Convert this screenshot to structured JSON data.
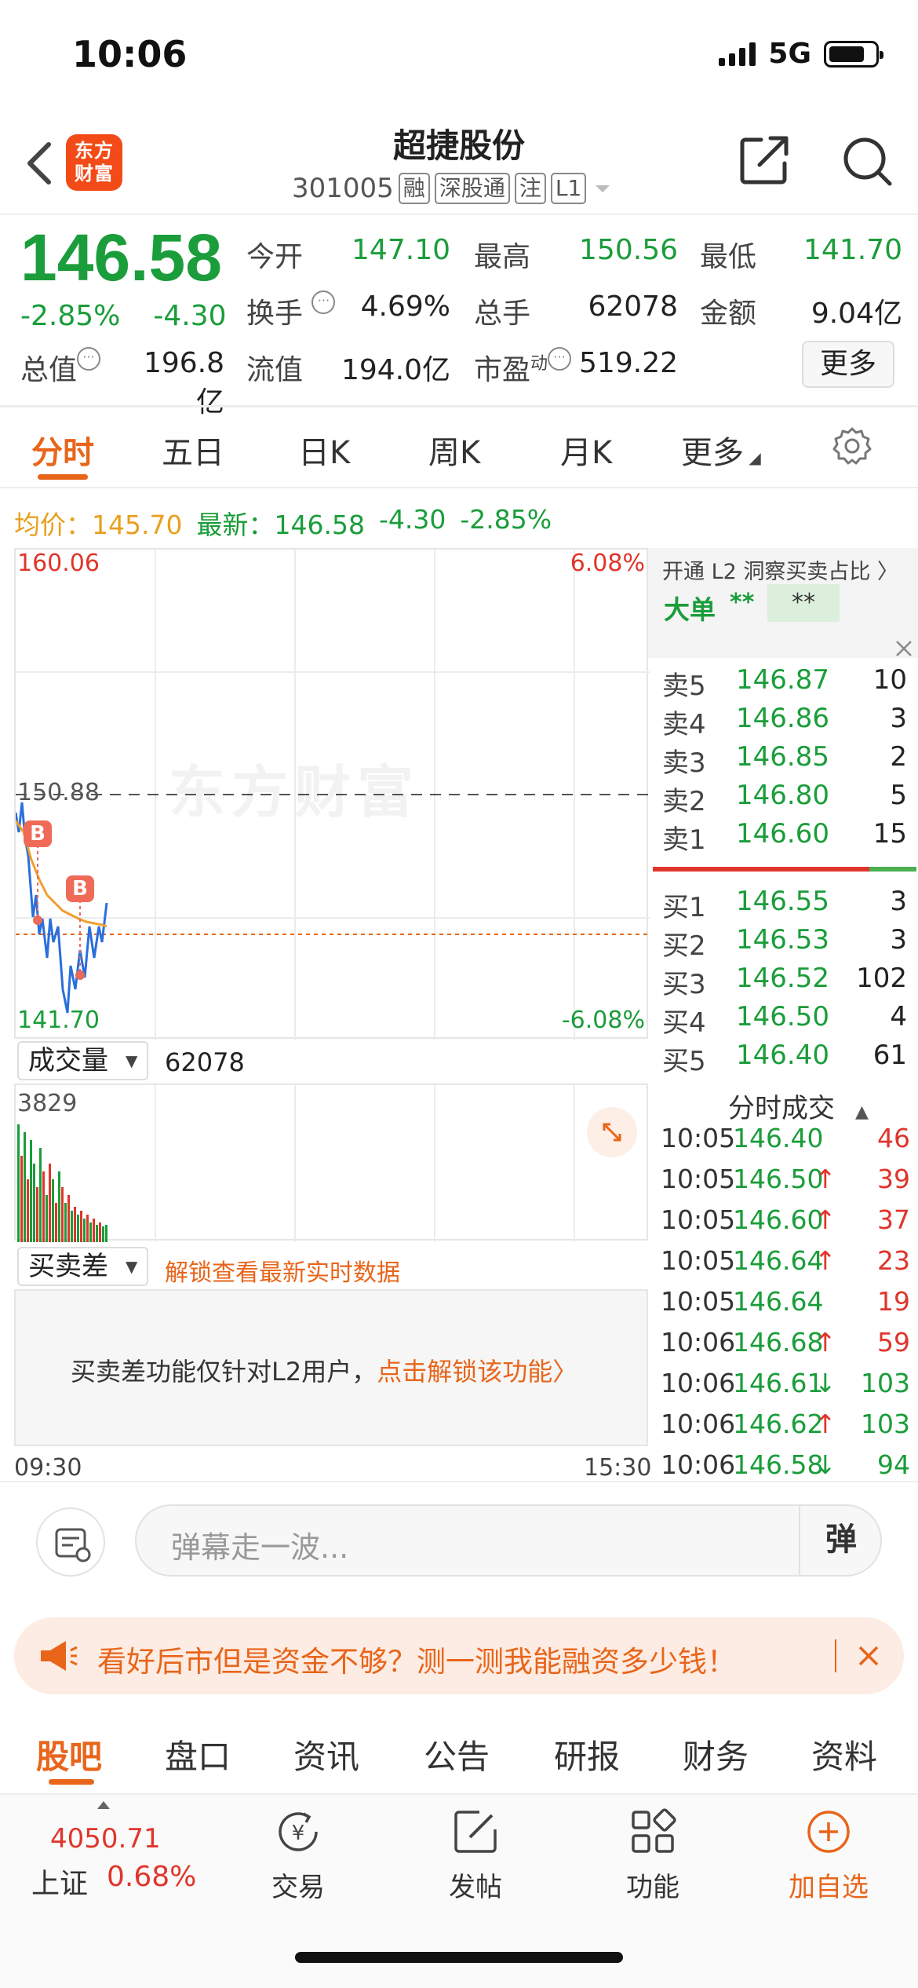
{
  "status_bar": {
    "time": "10:06",
    "network": "5G"
  },
  "header": {
    "logo_text_1": "东方",
    "logo_text_2": "财富",
    "stock_name": "超捷股份",
    "stock_code": "301005",
    "tags": [
      "融",
      "深股通",
      "注",
      "L1"
    ]
  },
  "quote": {
    "price": "146.58",
    "change_pct": "-2.85%",
    "change": "-4.30",
    "open_label": "今开",
    "open": "147.10",
    "high_label": "最高",
    "high": "150.56",
    "low_label": "最低",
    "low": "141.70",
    "turnover_label": "换手",
    "turnover": "4.69%",
    "volume_label": "总手",
    "volume": "62078",
    "amount_label": "金额",
    "amount": "9.04亿",
    "mktcap_label": "总值",
    "mktcap": "196.8亿",
    "float_label": "流值",
    "float": "194.0亿",
    "pe_label": "市盈",
    "pe_sup": "动",
    "pe": "519.22",
    "more_label": "更多"
  },
  "period_tabs": [
    "分时",
    "五日",
    "日K",
    "周K",
    "月K",
    "更多"
  ],
  "avg_row": {
    "avg_label": "均价：",
    "avg": "145.70",
    "latest_label": "最新：",
    "latest": "146.58",
    "change": "-4.30",
    "change_pct": "-2.85%"
  },
  "chart": {
    "y_max": "160.06",
    "y_min": "141.70",
    "y_mid": "150.88",
    "pct_max": "6.08%",
    "pct_min": "-6.08%",
    "watermark": "东方财富",
    "marker": "B",
    "time_start": "09:30",
    "time_end": "15:30",
    "volume_label": "成交量",
    "volume_value": "62078",
    "volume_max": "3829",
    "diff_label": "买卖差",
    "unlock_hint": "解锁查看最新实时数据",
    "diff_msg": "买卖差功能仅针对L2用户，",
    "diff_link": "点击解锁该功能"
  },
  "l2_panel": {
    "title": "开通 L2 洞察买卖占比",
    "big_order_label": "大单",
    "big_order_val": "**",
    "big_order_val2": "**"
  },
  "sell_orders": [
    {
      "label": "卖5",
      "price": "146.87",
      "vol": "10"
    },
    {
      "label": "卖4",
      "price": "146.86",
      "vol": "3"
    },
    {
      "label": "卖3",
      "price": "146.85",
      "vol": "2"
    },
    {
      "label": "卖2",
      "price": "146.80",
      "vol": "5"
    },
    {
      "label": "卖1",
      "price": "146.60",
      "vol": "15"
    }
  ],
  "buy_orders": [
    {
      "label": "买1",
      "price": "146.55",
      "vol": "3"
    },
    {
      "label": "买2",
      "price": "146.53",
      "vol": "3"
    },
    {
      "label": "买3",
      "price": "146.52",
      "vol": "102"
    },
    {
      "label": "买4",
      "price": "146.50",
      "vol": "4"
    },
    {
      "label": "买5",
      "price": "146.40",
      "vol": "61"
    }
  ],
  "ticks_title": "分时成交",
  "ticks": [
    {
      "time": "10:05",
      "price": "146.40",
      "arrow": "",
      "vol": "46",
      "color": "red"
    },
    {
      "time": "10:05",
      "price": "146.50",
      "arrow": "↑",
      "vol": "39",
      "color": "red"
    },
    {
      "time": "10:05",
      "price": "146.60",
      "arrow": "↑",
      "vol": "37",
      "color": "red"
    },
    {
      "time": "10:05",
      "price": "146.64",
      "arrow": "↑",
      "vol": "23",
      "color": "red"
    },
    {
      "time": "10:05",
      "price": "146.64",
      "arrow": "",
      "vol": "19",
      "color": "red"
    },
    {
      "time": "10:06",
      "price": "146.68",
      "arrow": "↑",
      "vol": "59",
      "color": "red"
    },
    {
      "time": "10:06",
      "price": "146.61",
      "arrow": "↓",
      "vol": "103",
      "color": "green"
    },
    {
      "time": "10:06",
      "price": "146.62",
      "arrow": "↑",
      "vol": "103",
      "color": "green"
    },
    {
      "time": "10:06",
      "price": "146.58",
      "arrow": "↓",
      "vol": "94",
      "color": "green"
    }
  ],
  "comment": {
    "placeholder": "弹幕走一波...",
    "danmu": "弹"
  },
  "banner": {
    "text": "看好后市但是资金不够？测一测我能融资多少钱！"
  },
  "bottom_tabs": [
    "股吧",
    "盘口",
    "资讯",
    "公告",
    "研报",
    "财务",
    "资料"
  ],
  "bottom_nav": {
    "index_value": "4050.71",
    "index_name": "上证",
    "index_pct": "0.68%",
    "items": [
      "交易",
      "发帖",
      "功能",
      "加自选"
    ]
  },
  "colors": {
    "accent": "#e8651a",
    "up": "#e0352b",
    "down": "#1a9d3a"
  }
}
